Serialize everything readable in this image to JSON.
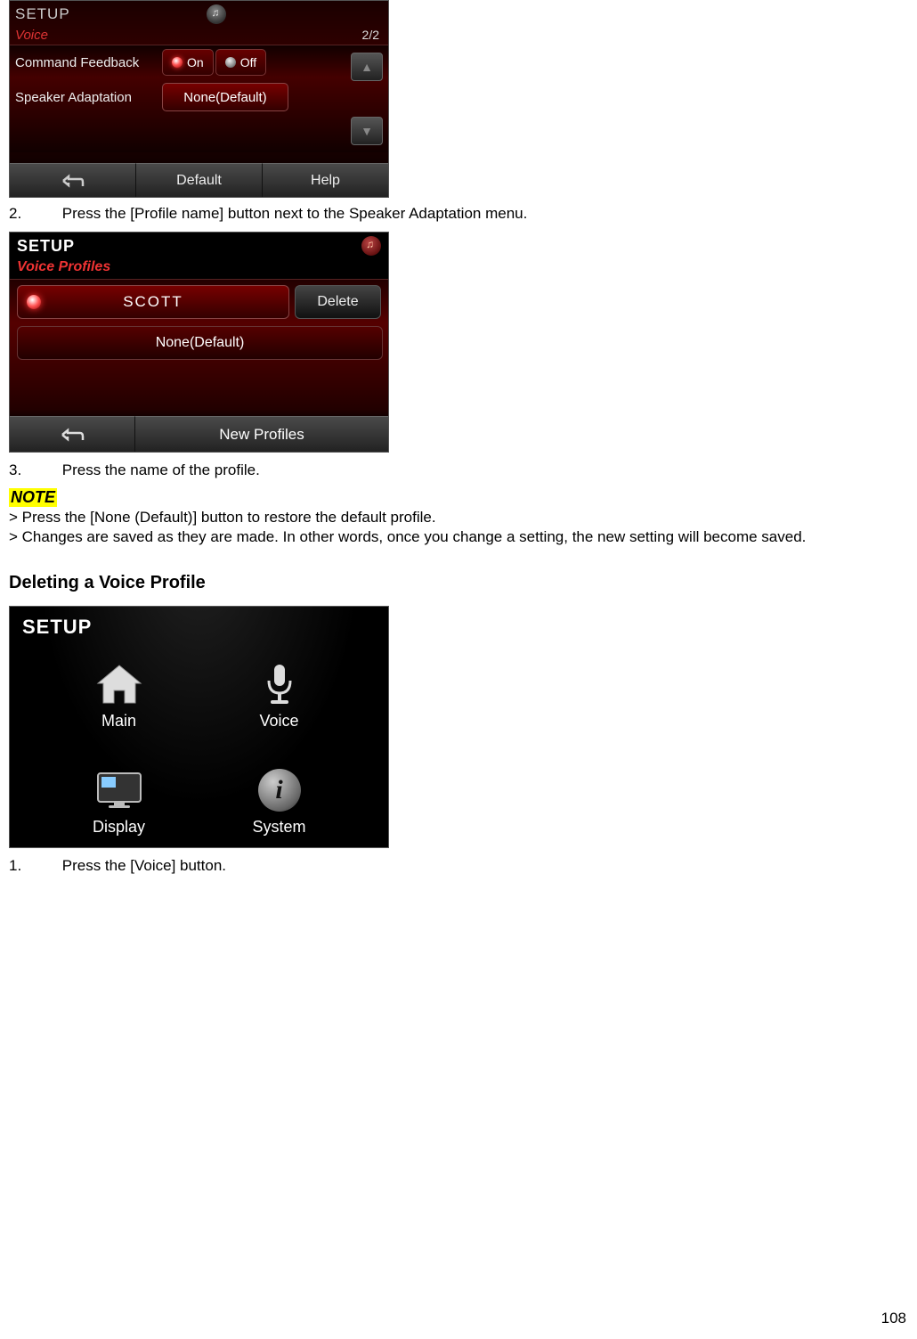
{
  "screenshot1": {
    "header": "SETUP",
    "section": "Voice",
    "page_indicator": "2/2",
    "rows": {
      "command_feedback": {
        "label": "Command Feedback",
        "on": "On",
        "off": "Off"
      },
      "speaker_adaptation": {
        "label": "Speaker Adaptation",
        "value": "None(Default)"
      }
    },
    "footer": {
      "default": "Default",
      "help": "Help"
    }
  },
  "step2": {
    "num": "2.",
    "text": "Press the [Profile name] button next to the Speaker Adaptation menu."
  },
  "screenshot2": {
    "header": "SETUP",
    "section": "Voice Profiles",
    "profile_name": "SCOTT",
    "delete": "Delete",
    "none_default": "None(Default)",
    "new_profiles": "New Profiles"
  },
  "step3": {
    "num": "3.",
    "text": "Press the name of the profile."
  },
  "note": {
    "label": "NOTE",
    "line1": "> Press the [None (Default)] button to restore the default profile.",
    "line2": "> Changes are saved as they are made. In other words, once you change a setting, the new setting will become saved."
  },
  "heading_delete": "Deleting a Voice Profile",
  "screenshot3": {
    "header": "SETUP",
    "tiles": {
      "main": "Main",
      "voice": "Voice",
      "display": "Display",
      "system": "System"
    }
  },
  "step1": {
    "num": "1.",
    "text": "Press the [Voice] button."
  },
  "page_number": "108"
}
